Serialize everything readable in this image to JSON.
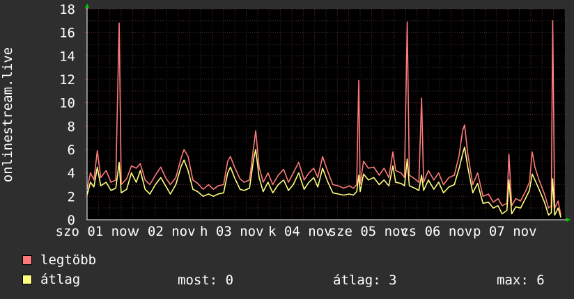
{
  "chart_data": {
    "type": "line",
    "ylabel": "onlinestream.live",
    "ylim": [
      0,
      18
    ],
    "yticks": [
      0,
      2,
      4,
      6,
      8,
      10,
      12,
      14,
      16,
      18
    ],
    "xlim": [
      0,
      7
    ],
    "grid": true,
    "x_tick_labels": [
      {
        "pos": 0.12,
        "label": "szo 01 nov"
      },
      {
        "pos": 1.12,
        "label": "v 02 nov"
      },
      {
        "pos": 2.12,
        "label": "h 03 nov"
      },
      {
        "pos": 3.12,
        "label": "k 04 nov"
      },
      {
        "pos": 4.12,
        "label": "sze 05 nov"
      },
      {
        "pos": 5.12,
        "label": "cs 06 nov"
      },
      {
        "pos": 6.12,
        "label": "p 07 nov"
      }
    ],
    "series": [
      {
        "name": "legtöbb",
        "color": "#ff7a7a",
        "points": [
          [
            0.0,
            2.6
          ],
          [
            0.05,
            4.0
          ],
          [
            0.1,
            3.4
          ],
          [
            0.15,
            5.9
          ],
          [
            0.2,
            3.6
          ],
          [
            0.28,
            4.2
          ],
          [
            0.35,
            3.2
          ],
          [
            0.42,
            3.4
          ],
          [
            0.47,
            16.8
          ],
          [
            0.5,
            3.0
          ],
          [
            0.58,
            3.5
          ],
          [
            0.65,
            4.6
          ],
          [
            0.72,
            4.4
          ],
          [
            0.78,
            4.8
          ],
          [
            0.85,
            3.4
          ],
          [
            0.92,
            3.0
          ],
          [
            1.0,
            3.8
          ],
          [
            1.08,
            4.5
          ],
          [
            1.15,
            3.6
          ],
          [
            1.22,
            3.0
          ],
          [
            1.3,
            3.6
          ],
          [
            1.38,
            5.3
          ],
          [
            1.42,
            6.0
          ],
          [
            1.48,
            5.4
          ],
          [
            1.55,
            3.4
          ],
          [
            1.62,
            3.1
          ],
          [
            1.7,
            2.6
          ],
          [
            1.78,
            3.0
          ],
          [
            1.85,
            2.6
          ],
          [
            1.92,
            2.9
          ],
          [
            2.0,
            3.0
          ],
          [
            2.06,
            5.0
          ],
          [
            2.1,
            5.4
          ],
          [
            2.16,
            4.5
          ],
          [
            2.24,
            3.5
          ],
          [
            2.3,
            3.2
          ],
          [
            2.38,
            3.4
          ],
          [
            2.44,
            6.2
          ],
          [
            2.47,
            7.6
          ],
          [
            2.52,
            4.5
          ],
          [
            2.58,
            3.2
          ],
          [
            2.65,
            4.0
          ],
          [
            2.72,
            3.0
          ],
          [
            2.8,
            3.8
          ],
          [
            2.88,
            4.3
          ],
          [
            2.95,
            3.2
          ],
          [
            3.02,
            4.0
          ],
          [
            3.1,
            4.9
          ],
          [
            3.18,
            3.4
          ],
          [
            3.25,
            4.0
          ],
          [
            3.32,
            4.4
          ],
          [
            3.38,
            3.6
          ],
          [
            3.45,
            5.4
          ],
          [
            3.52,
            4.2
          ],
          [
            3.6,
            3.0
          ],
          [
            3.68,
            2.9
          ],
          [
            3.76,
            2.7
          ],
          [
            3.84,
            2.9
          ],
          [
            3.9,
            2.7
          ],
          [
            3.95,
            3.0
          ],
          [
            3.98,
            11.9
          ],
          [
            4.0,
            3.0
          ],
          [
            4.05,
            5.0
          ],
          [
            4.12,
            4.4
          ],
          [
            4.2,
            4.5
          ],
          [
            4.28,
            3.8
          ],
          [
            4.35,
            4.4
          ],
          [
            4.42,
            3.6
          ],
          [
            4.48,
            5.8
          ],
          [
            4.52,
            4.2
          ],
          [
            4.6,
            4.0
          ],
          [
            4.65,
            3.6
          ],
          [
            4.69,
            16.9
          ],
          [
            4.72,
            3.8
          ],
          [
            4.8,
            3.5
          ],
          [
            4.86,
            3.2
          ],
          [
            4.9,
            10.4
          ],
          [
            4.93,
            3.2
          ],
          [
            5.0,
            4.2
          ],
          [
            5.08,
            3.4
          ],
          [
            5.15,
            4.0
          ],
          [
            5.22,
            3.0
          ],
          [
            5.3,
            3.6
          ],
          [
            5.38,
            3.8
          ],
          [
            5.45,
            5.5
          ],
          [
            5.5,
            7.6
          ],
          [
            5.53,
            8.1
          ],
          [
            5.58,
            5.5
          ],
          [
            5.65,
            3.0
          ],
          [
            5.72,
            4.0
          ],
          [
            5.8,
            2.0
          ],
          [
            5.88,
            2.2
          ],
          [
            5.95,
            1.5
          ],
          [
            6.02,
            1.8
          ],
          [
            6.08,
            1.2
          ],
          [
            6.15,
            1.4
          ],
          [
            6.18,
            5.6
          ],
          [
            6.22,
            1.2
          ],
          [
            6.28,
            1.8
          ],
          [
            6.35,
            1.6
          ],
          [
            6.42,
            2.4
          ],
          [
            6.48,
            3.2
          ],
          [
            6.52,
            5.8
          ],
          [
            6.56,
            4.5
          ],
          [
            6.62,
            3.4
          ],
          [
            6.7,
            2.2
          ],
          [
            6.76,
            1.0
          ],
          [
            6.8,
            1.2
          ],
          [
            6.82,
            17.0
          ],
          [
            6.85,
            1.0
          ],
          [
            6.9,
            1.6
          ],
          [
            6.94,
            0.4
          ]
        ]
      },
      {
        "name": "átlag",
        "color": "#ffff80",
        "points": [
          [
            0.0,
            2.1
          ],
          [
            0.05,
            3.2
          ],
          [
            0.1,
            2.8
          ],
          [
            0.15,
            4.5
          ],
          [
            0.2,
            2.9
          ],
          [
            0.28,
            3.2
          ],
          [
            0.35,
            2.5
          ],
          [
            0.42,
            2.7
          ],
          [
            0.47,
            4.9
          ],
          [
            0.5,
            2.3
          ],
          [
            0.58,
            2.6
          ],
          [
            0.65,
            4.0
          ],
          [
            0.72,
            3.2
          ],
          [
            0.78,
            4.2
          ],
          [
            0.85,
            2.6
          ],
          [
            0.92,
            2.2
          ],
          [
            1.0,
            3.0
          ],
          [
            1.08,
            3.6
          ],
          [
            1.15,
            2.9
          ],
          [
            1.22,
            2.2
          ],
          [
            1.3,
            3.0
          ],
          [
            1.38,
            4.6
          ],
          [
            1.42,
            5.1
          ],
          [
            1.48,
            4.2
          ],
          [
            1.55,
            2.6
          ],
          [
            1.62,
            2.4
          ],
          [
            1.7,
            2.0
          ],
          [
            1.78,
            2.2
          ],
          [
            1.85,
            2.0
          ],
          [
            1.92,
            2.2
          ],
          [
            2.0,
            2.3
          ],
          [
            2.06,
            4.0
          ],
          [
            2.1,
            4.5
          ],
          [
            2.16,
            3.6
          ],
          [
            2.24,
            2.6
          ],
          [
            2.3,
            2.5
          ],
          [
            2.38,
            2.7
          ],
          [
            2.44,
            5.2
          ],
          [
            2.47,
            6.0
          ],
          [
            2.52,
            3.6
          ],
          [
            2.58,
            2.4
          ],
          [
            2.65,
            3.2
          ],
          [
            2.72,
            2.3
          ],
          [
            2.8,
            3.0
          ],
          [
            2.88,
            3.4
          ],
          [
            2.95,
            2.5
          ],
          [
            3.02,
            3.0
          ],
          [
            3.1,
            4.0
          ],
          [
            3.18,
            2.6
          ],
          [
            3.25,
            3.2
          ],
          [
            3.32,
            3.6
          ],
          [
            3.38,
            2.8
          ],
          [
            3.45,
            4.4
          ],
          [
            3.52,
            3.3
          ],
          [
            3.6,
            2.3
          ],
          [
            3.68,
            2.2
          ],
          [
            3.76,
            2.1
          ],
          [
            3.84,
            2.2
          ],
          [
            3.9,
            2.1
          ],
          [
            3.95,
            2.4
          ],
          [
            3.98,
            3.8
          ],
          [
            4.0,
            2.4
          ],
          [
            4.05,
            3.9
          ],
          [
            4.12,
            3.4
          ],
          [
            4.2,
            3.6
          ],
          [
            4.28,
            3.0
          ],
          [
            4.35,
            3.4
          ],
          [
            4.42,
            2.9
          ],
          [
            4.48,
            4.6
          ],
          [
            4.52,
            3.2
          ],
          [
            4.6,
            3.1
          ],
          [
            4.65,
            2.9
          ],
          [
            4.69,
            5.2
          ],
          [
            4.72,
            2.9
          ],
          [
            4.8,
            2.7
          ],
          [
            4.86,
            2.5
          ],
          [
            4.9,
            3.8
          ],
          [
            4.93,
            2.5
          ],
          [
            5.0,
            3.4
          ],
          [
            5.08,
            2.6
          ],
          [
            5.15,
            3.2
          ],
          [
            5.22,
            2.3
          ],
          [
            5.3,
            2.8
          ],
          [
            5.38,
            3.0
          ],
          [
            5.45,
            4.4
          ],
          [
            5.5,
            5.6
          ],
          [
            5.53,
            6.2
          ],
          [
            5.58,
            4.4
          ],
          [
            5.65,
            2.3
          ],
          [
            5.72,
            3.1
          ],
          [
            5.8,
            1.4
          ],
          [
            5.88,
            1.5
          ],
          [
            5.95,
            1.0
          ],
          [
            6.02,
            1.2
          ],
          [
            6.08,
            0.5
          ],
          [
            6.15,
            0.8
          ],
          [
            6.18,
            3.4
          ],
          [
            6.22,
            0.5
          ],
          [
            6.28,
            1.1
          ],
          [
            6.35,
            1.0
          ],
          [
            6.42,
            1.8
          ],
          [
            6.48,
            2.5
          ],
          [
            6.52,
            3.9
          ],
          [
            6.56,
            3.4
          ],
          [
            6.62,
            2.6
          ],
          [
            6.7,
            1.5
          ],
          [
            6.76,
            0.4
          ],
          [
            6.8,
            0.6
          ],
          [
            6.82,
            3.5
          ],
          [
            6.85,
            0.4
          ],
          [
            6.9,
            1.0
          ],
          [
            6.94,
            0.2
          ]
        ]
      }
    ]
  },
  "legend": {
    "items": [
      {
        "label": "legtöbb",
        "color": "#ff7a7a"
      },
      {
        "label": "átlag",
        "color": "#ffff80"
      }
    ]
  },
  "stats": {
    "now": "most: 0",
    "avg": "átlag: 3",
    "max": "max: 6"
  }
}
